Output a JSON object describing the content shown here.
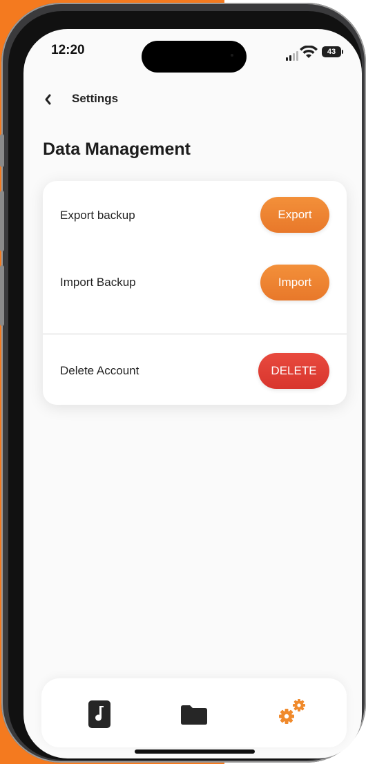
{
  "status": {
    "time": "12:20",
    "battery": "43"
  },
  "nav": {
    "back_icon": "chevron-left-icon",
    "back_label": "Settings"
  },
  "page": {
    "title": "Data Management"
  },
  "rows": [
    {
      "label": "Export backup",
      "button": "Export"
    },
    {
      "label": "Import Backup",
      "button": "Import"
    },
    {
      "label": "Delete Account",
      "button": "DELETE"
    }
  ],
  "tabs": [
    {
      "icon": "music-note-icon"
    },
    {
      "icon": "folder-icon"
    },
    {
      "icon": "gears-icon",
      "active": true
    }
  ],
  "colors": {
    "accent": "#f0843a",
    "danger": "#e0403a",
    "frame_background": "#f47a1f"
  }
}
